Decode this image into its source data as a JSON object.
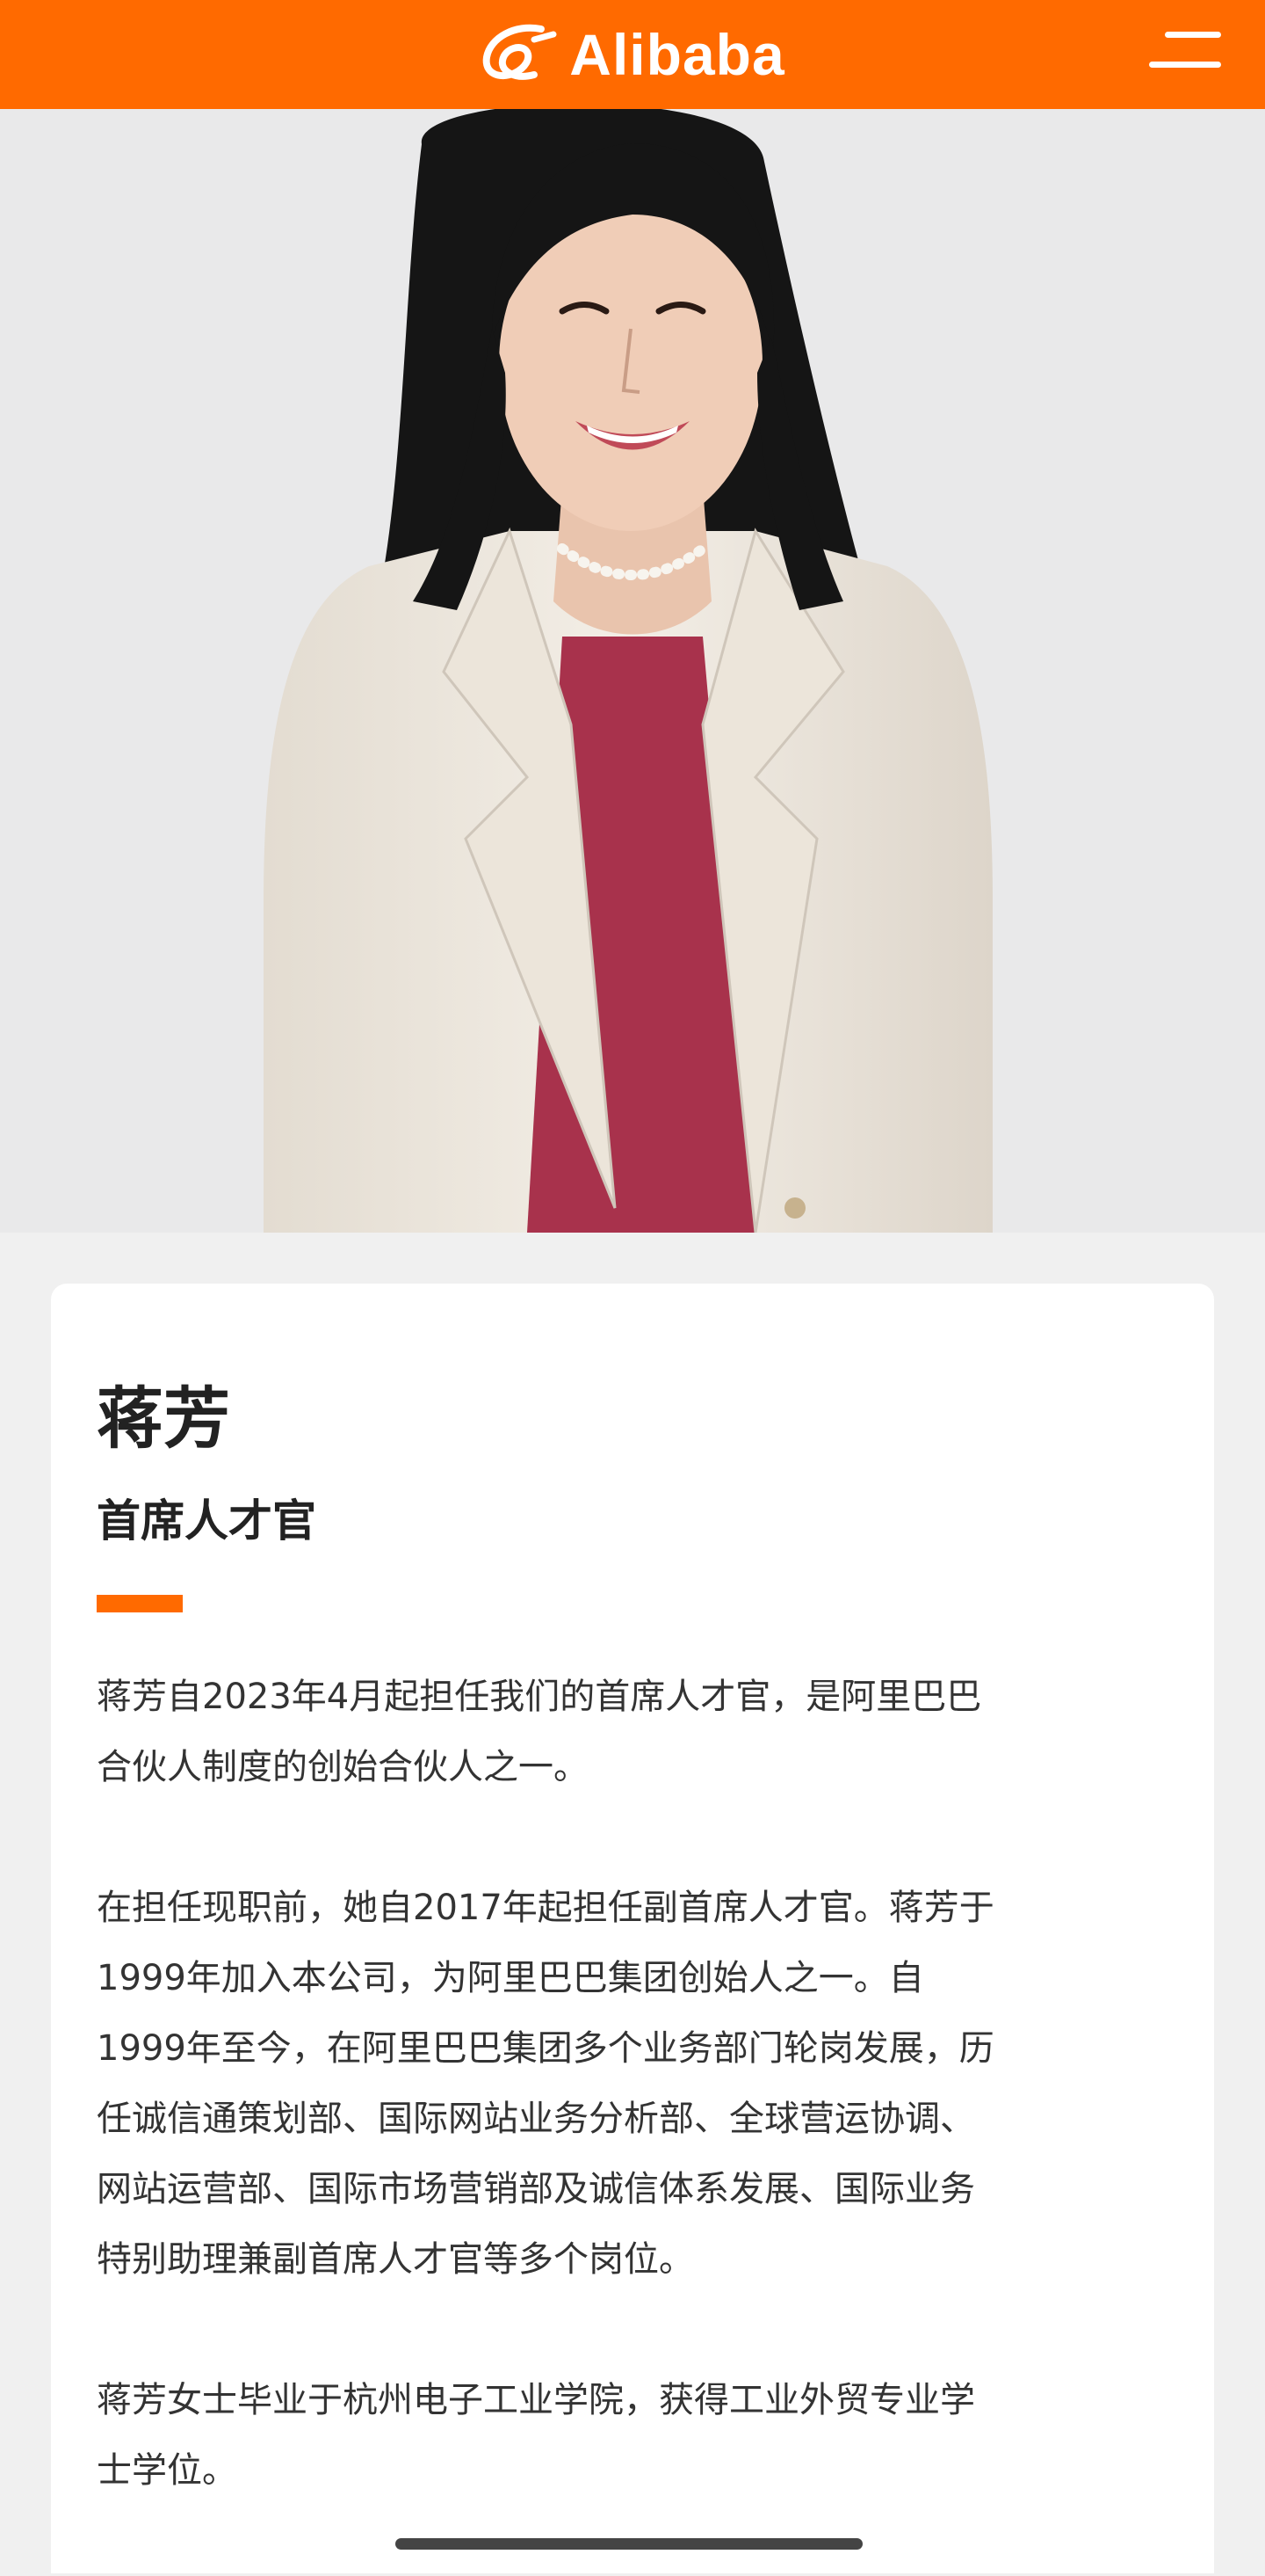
{
  "header": {
    "logo_text": "Alibaba",
    "menu_icon": "hamburger-menu-icon",
    "background_color": "#ff6a00"
  },
  "hero": {
    "image_subject": "portrait-photo",
    "background_color": "#e9e9ea"
  },
  "profile": {
    "name": "蒋芳",
    "title": "首席人才官",
    "accent_color": "#ff6a00",
    "bio": [
      "蒋芳自2023年4月起担任我们的首席人才官，是阿里巴巴\n合伙人制度的创始合伙人之一。",
      "在担任现职前，她自2017年起担任副首席人才官。蒋芳于\n1999年加入本公司，为阿里巴巴集团创始人之一。自\n1999年至今，在阿里巴巴集团多个业务部门轮岗发展，历\n任诚信通策划部、国际网站业务分析部、全球营运协调、\n网站运营部、国际市场营销部及诚信体系发展、国际业务\n特别助理兼副首席人才官等多个岗位。",
      "蒋芳女士毕业于杭州电子工业学院，获得工业外贸专业学\n士学位。"
    ]
  }
}
